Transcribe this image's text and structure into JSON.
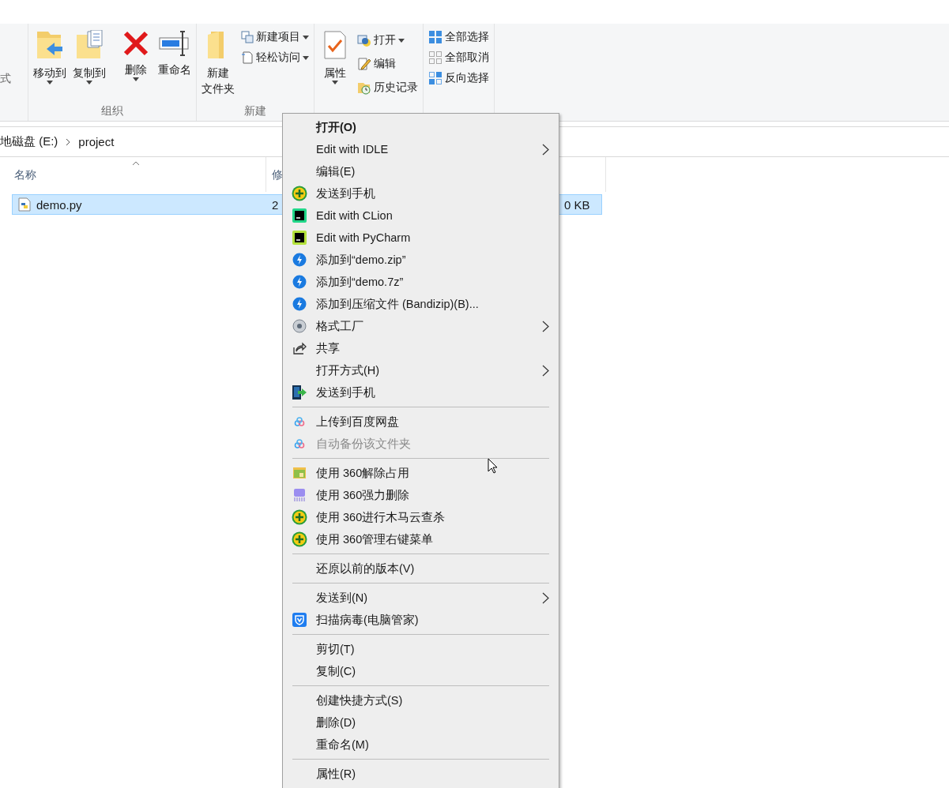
{
  "ribbon": {
    "clipped_label": "式",
    "groups": [
      {
        "label": "组织",
        "large": [
          {
            "lines": [
              "移动到"
            ],
            "dropdown": true
          },
          {
            "lines": [
              "复制到"
            ],
            "dropdown": true
          },
          {
            "lines": [
              "删除"
            ],
            "dropdown": true
          },
          {
            "lines": [
              "重命名"
            ],
            "dropdown": false
          }
        ]
      },
      {
        "label": "新建",
        "large": [
          {
            "lines": [
              "新建",
              "文件夹"
            ],
            "dropdown": false
          }
        ],
        "small": [
          {
            "label": "新建项目",
            "dropdown": true
          },
          {
            "label": "轻松访问",
            "dropdown": true
          }
        ]
      },
      {
        "large": [
          {
            "lines": [
              "属性"
            ],
            "dropdown": true
          }
        ],
        "small": [
          {
            "label": "打开",
            "dropdown": true
          },
          {
            "label": "编辑",
            "dropdown": false
          },
          {
            "label": "历史记录",
            "dropdown": false
          }
        ]
      },
      {
        "small": [
          {
            "label": "全部选择",
            "dropdown": false
          },
          {
            "label": "全部取消",
            "dropdown": false
          },
          {
            "label": "反向选择",
            "dropdown": false
          }
        ]
      }
    ]
  },
  "address": {
    "crumbs": [
      "地磁盘 (E:)",
      "project"
    ]
  },
  "columns": [
    {
      "label": "名称",
      "sorted": true
    },
    {
      "label": "修"
    }
  ],
  "files": [
    {
      "name": "demo.py",
      "column_2": "2",
      "size": "0 KB",
      "selected": true
    }
  ],
  "context_menu": [
    {
      "kind": "item",
      "label": "打开(O)",
      "default": true,
      "submenu": false,
      "disabled": false
    },
    {
      "kind": "item",
      "label": "Edit with IDLE",
      "default": false,
      "submenu": true,
      "disabled": false
    },
    {
      "kind": "item",
      "label": "编辑(E)",
      "default": false,
      "submenu": false,
      "disabled": false
    },
    {
      "kind": "item",
      "label": "发送到手机",
      "default": false,
      "submenu": false,
      "disabled": false
    },
    {
      "kind": "item",
      "label": "Edit with CLion",
      "default": false,
      "submenu": false,
      "disabled": false
    },
    {
      "kind": "item",
      "label": "Edit with PyCharm",
      "default": false,
      "submenu": false,
      "disabled": false
    },
    {
      "kind": "item",
      "label": "添加到“demo.zip”",
      "default": false,
      "submenu": false,
      "disabled": false
    },
    {
      "kind": "item",
      "label": "添加到“demo.7z”",
      "default": false,
      "submenu": false,
      "disabled": false
    },
    {
      "kind": "item",
      "label": "添加到压缩文件 (Bandizip)(B)...",
      "default": false,
      "submenu": false,
      "disabled": false
    },
    {
      "kind": "item",
      "label": "格式工厂",
      "default": false,
      "submenu": true,
      "disabled": false
    },
    {
      "kind": "item",
      "label": "共享",
      "default": false,
      "submenu": false,
      "disabled": false
    },
    {
      "kind": "item",
      "label": "打开方式(H)",
      "default": false,
      "submenu": true,
      "disabled": false
    },
    {
      "kind": "item",
      "label": "发送到手机",
      "default": false,
      "submenu": false,
      "disabled": false
    },
    {
      "kind": "separator"
    },
    {
      "kind": "item",
      "label": "上传到百度网盘",
      "default": false,
      "submenu": false,
      "disabled": false
    },
    {
      "kind": "item",
      "label": "自动备份该文件夹",
      "default": false,
      "submenu": false,
      "disabled": true
    },
    {
      "kind": "separator"
    },
    {
      "kind": "item",
      "label": "使用 360解除占用",
      "default": false,
      "submenu": false,
      "disabled": false
    },
    {
      "kind": "item",
      "label": "使用 360强力删除",
      "default": false,
      "submenu": false,
      "disabled": false
    },
    {
      "kind": "item",
      "label": "使用 360进行木马云查杀",
      "default": false,
      "submenu": false,
      "disabled": false
    },
    {
      "kind": "item",
      "label": "使用 360管理右键菜单",
      "default": false,
      "submenu": false,
      "disabled": false
    },
    {
      "kind": "separator"
    },
    {
      "kind": "item",
      "label": "还原以前的版本(V)",
      "default": false,
      "submenu": false,
      "disabled": false
    },
    {
      "kind": "separator"
    },
    {
      "kind": "item",
      "label": "发送到(N)",
      "default": false,
      "submenu": true,
      "disabled": false
    },
    {
      "kind": "item",
      "label": "扫描病毒(电脑管家)",
      "default": false,
      "submenu": false,
      "disabled": false
    },
    {
      "kind": "separator"
    },
    {
      "kind": "item",
      "label": "剪切(T)",
      "default": false,
      "submenu": false,
      "disabled": false
    },
    {
      "kind": "item",
      "label": "复制(C)",
      "default": false,
      "submenu": false,
      "disabled": false
    },
    {
      "kind": "separator"
    },
    {
      "kind": "item",
      "label": "创建快捷方式(S)",
      "default": false,
      "submenu": false,
      "disabled": false
    },
    {
      "kind": "item",
      "label": "删除(D)",
      "default": false,
      "submenu": false,
      "disabled": false
    },
    {
      "kind": "item",
      "label": "重命名(M)",
      "default": false,
      "submenu": false,
      "disabled": false
    },
    {
      "kind": "separator"
    },
    {
      "kind": "item",
      "label": "属性(R)",
      "default": false,
      "submenu": false,
      "disabled": false
    }
  ]
}
